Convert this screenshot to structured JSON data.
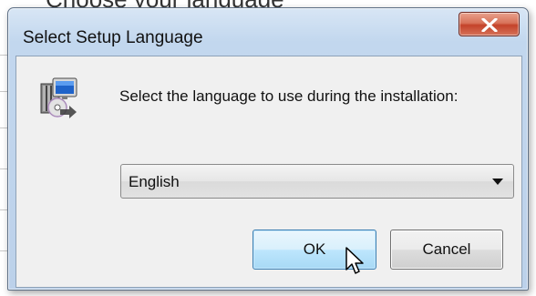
{
  "background": {
    "heading": "Choose your language"
  },
  "dialog": {
    "title": "Select Setup Language",
    "close_glyph": "X",
    "prompt": "Select the language to use during the installation:",
    "language": {
      "selected": "English"
    },
    "buttons": {
      "ok_label": "OK",
      "cancel_label": "Cancel"
    }
  },
  "icons": {
    "app": "setup-installer-icon",
    "close": "close-icon",
    "dropdown": "chevron-down-icon",
    "cursor": "mouse-pointer-icon"
  },
  "colors": {
    "title_bar": "#c2d7ee",
    "close_button": "#c4432a",
    "ok_button_border": "#3c7fb1",
    "content_background": "#f0f0f0"
  }
}
